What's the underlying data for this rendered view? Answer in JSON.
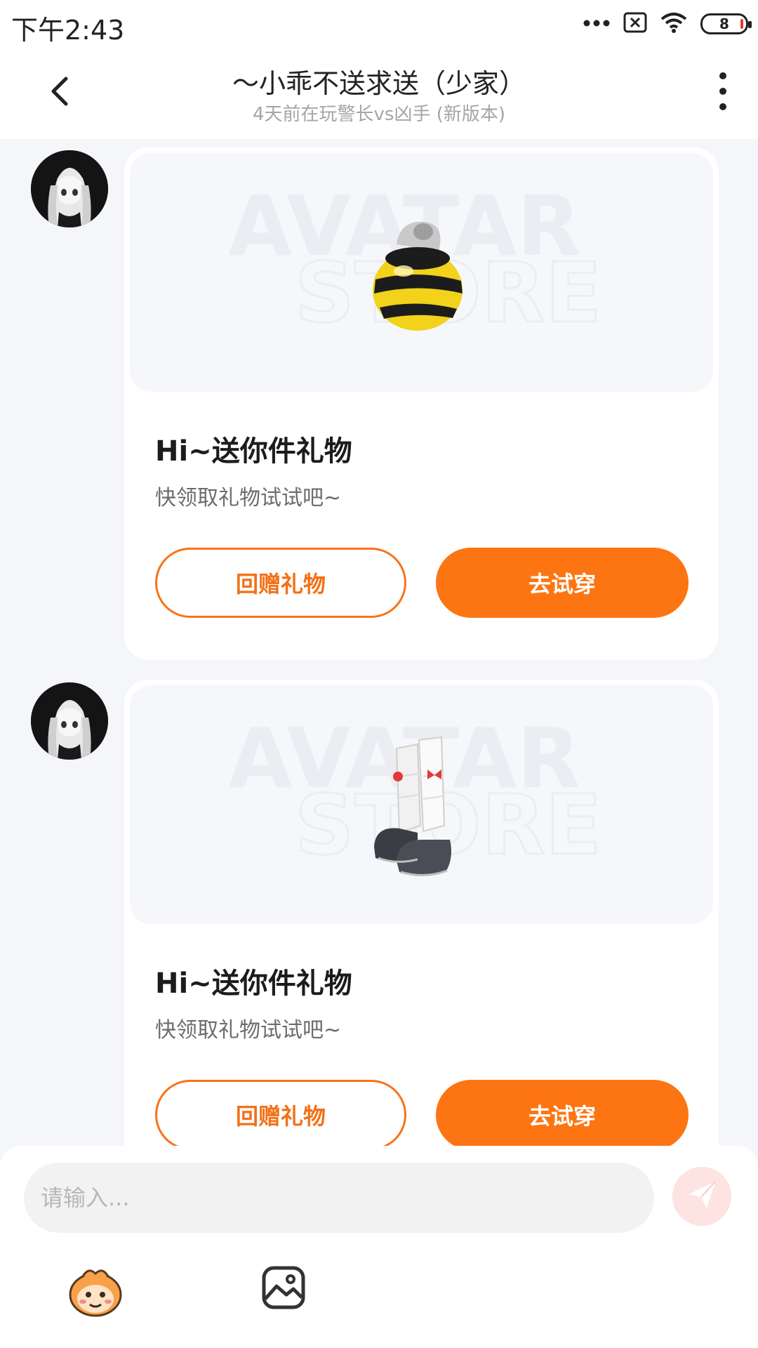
{
  "status_bar": {
    "time": "下午2:43",
    "battery_level": "8",
    "icons": [
      "more-dots-icon",
      "sim-error-icon",
      "wifi-icon",
      "battery-icon"
    ]
  },
  "header": {
    "title": "～小乖不送求送（少家）",
    "subtitle": "4天前在玩警长vs凶手 (新版本)",
    "back_icon": "chevron-left-icon",
    "more_icon": "vertical-dots-icon"
  },
  "messages": [
    {
      "item_icon": "bee-round-item-icon",
      "watermark_top": "AVATAR",
      "watermark_bottom": "STORE",
      "title": "Hi~送你件礼物",
      "subtitle": "快领取礼物试试吧~",
      "return_gift_label": "回赠礼物",
      "try_on_label": "去试穿"
    },
    {
      "item_icon": "leg-warmers-shoes-item-icon",
      "watermark_top": "AVATAR",
      "watermark_bottom": "STORE",
      "title": "Hi~送你件礼物",
      "subtitle": "快领取礼物试试吧~",
      "return_gift_label": "回赠礼物",
      "try_on_label": "去试穿"
    }
  ],
  "input_bar": {
    "placeholder": "请输入...",
    "send_icon": "paper-plane-icon",
    "emoji_icon": "monkey-face-icon",
    "image_icon": "image-icon"
  },
  "colors": {
    "accent": "#fd7512",
    "background": "#f4f6fa",
    "send_button": "#fde3e1"
  }
}
